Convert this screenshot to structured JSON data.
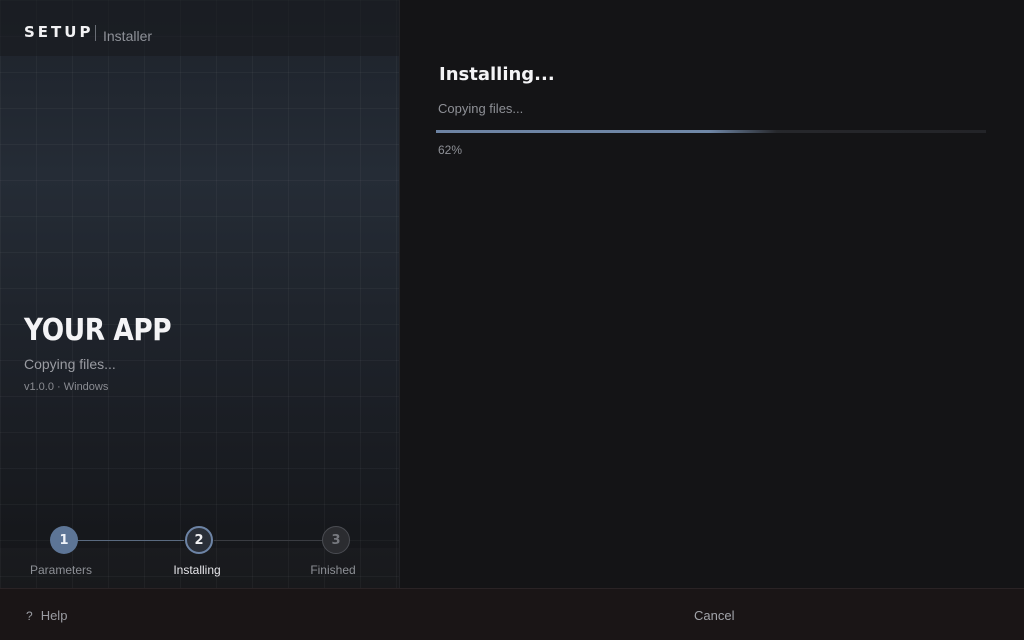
{
  "header": {
    "brand": "SETUP",
    "subtitle": "Installer"
  },
  "app": {
    "name": "YOUR APP",
    "status": "Copying files...",
    "meta": "v1.0.0 · Windows"
  },
  "steps": [
    {
      "number": "1",
      "label": "Parameters",
      "state": "done"
    },
    {
      "number": "2",
      "label": "Installing",
      "state": "active"
    },
    {
      "number": "3",
      "label": "Finished",
      "state": "pending"
    }
  ],
  "main": {
    "title": "Installing...",
    "status": "Copying files...",
    "progress": 0.62,
    "percent_label": "62%"
  },
  "footer": {
    "help_icon": "?",
    "help_label": "Help",
    "cancel_label": "Cancel"
  },
  "colors": {
    "accent": "#6d84a6",
    "background": "#141416"
  }
}
